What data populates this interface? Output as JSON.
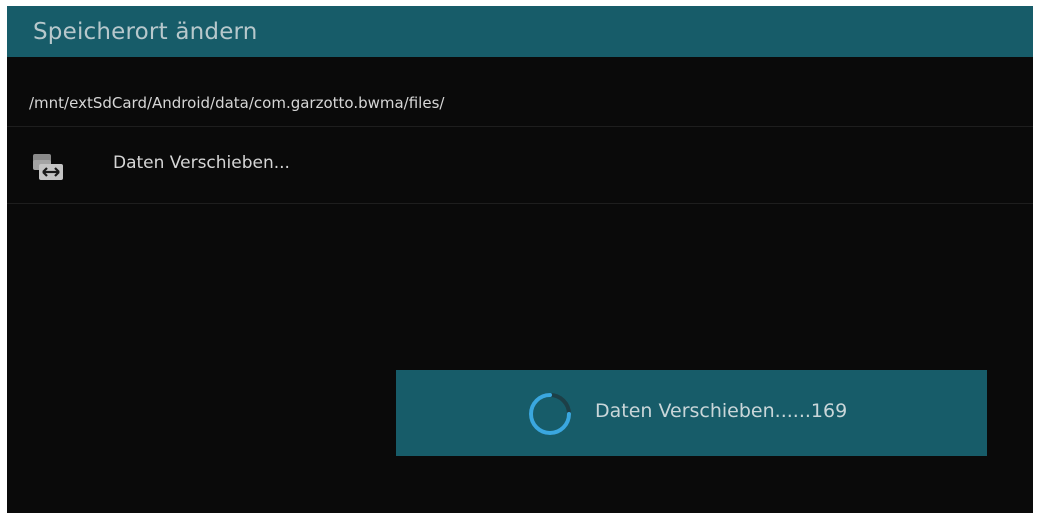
{
  "dialog": {
    "title": "Speicherort ändern"
  },
  "storage": {
    "path": "/mnt/extSdCard/Android/data/com.garzotto.bwma/files/"
  },
  "action": {
    "label": "Daten Verschieben...",
    "icon": "move-data-icon"
  },
  "progress": {
    "text": "Daten Verschieben......169",
    "icon": "loading-spinner-icon"
  },
  "colors": {
    "accent": "#175c69",
    "background": "#0a0a0a",
    "text": "#d6d6d6"
  }
}
